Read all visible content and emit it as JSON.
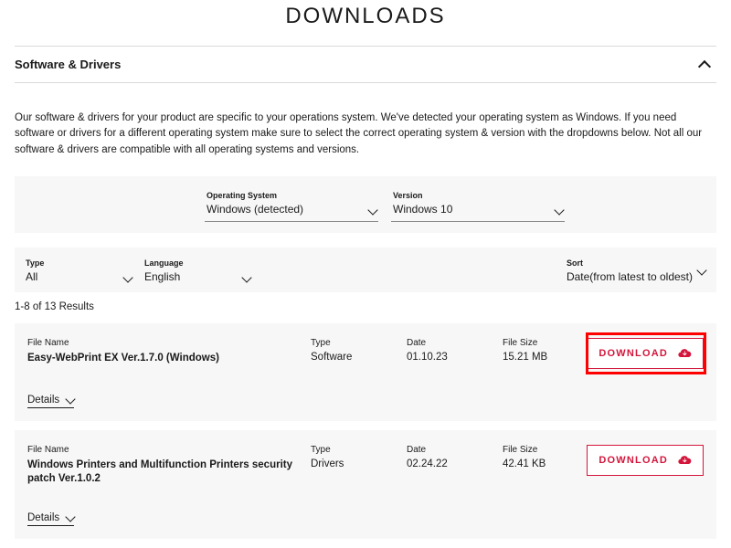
{
  "page_title": "DOWNLOADS",
  "accordion_title": "Software & Drivers",
  "intro_text": "Our software & drivers for your product are specific to your operations system. We've detected your operating system as Windows. If you need software or drivers for a different operating system make sure to select the correct operating system & version with the dropdowns below. Not all our software & drivers are compatible with all operating systems and versions.",
  "os_dropdown": {
    "label": "Operating System",
    "value": "Windows (detected)"
  },
  "version_dropdown": {
    "label": "Version",
    "value": "Windows 10"
  },
  "type_filter": {
    "label": "Type",
    "value": "All"
  },
  "lang_filter": {
    "label": "Language",
    "value": "English"
  },
  "sort_filter": {
    "label": "Sort",
    "value": "Date(from latest to oldest)"
  },
  "results_count": "1-8 of 13 Results",
  "col_labels": {
    "file": "File Name",
    "type": "Type",
    "date": "Date",
    "size": "File Size"
  },
  "details_label": "Details",
  "download_label": "DOWNLOAD",
  "results": [
    {
      "file": "Easy-WebPrint EX Ver.1.7.0 (Windows)",
      "type": "Software",
      "date": "01.10.23",
      "size": "15.21 MB"
    },
    {
      "file": "Windows Printers and Multifunction Printers security patch Ver.1.0.2",
      "type": "Drivers",
      "date": "02.24.22",
      "size": "42.41 KB"
    }
  ]
}
